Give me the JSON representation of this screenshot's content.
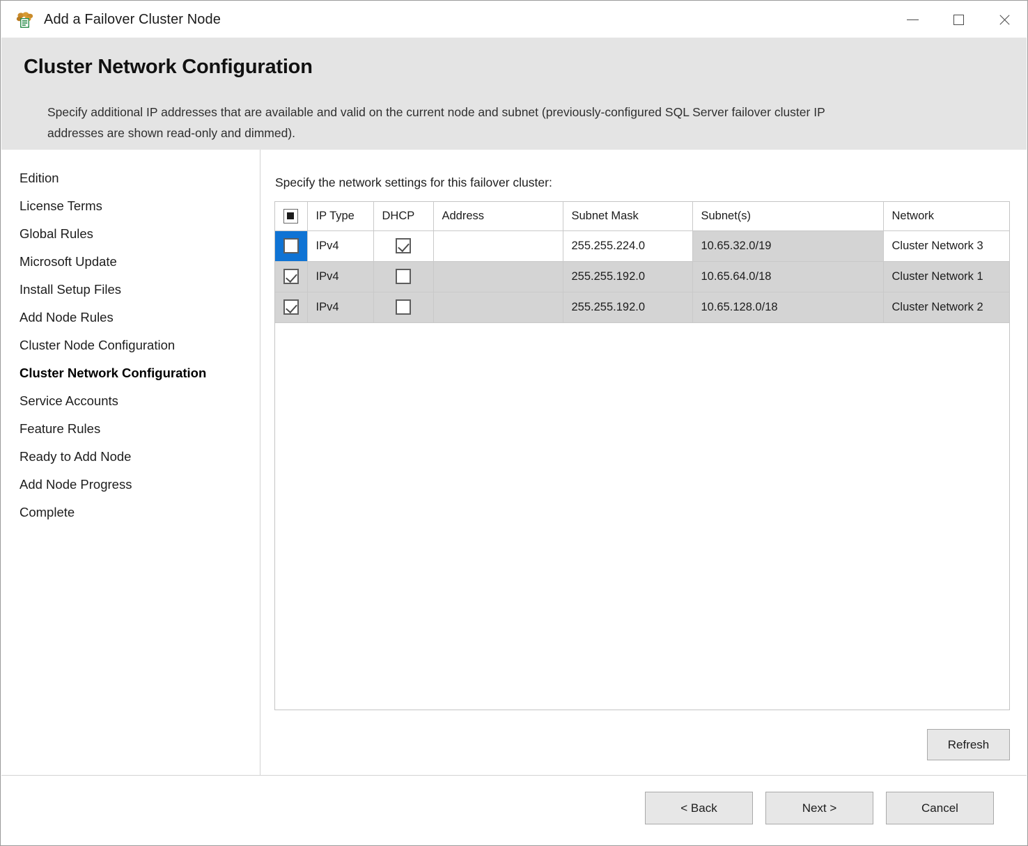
{
  "window": {
    "title": "Add a Failover Cluster Node",
    "icon": "sql-server-cluster-icon",
    "controls": {
      "minimize": "minimize-icon",
      "maximize": "maximize-icon",
      "close": "close-icon"
    }
  },
  "banner": {
    "title": "Cluster Network Configuration",
    "description": "Specify additional IP addresses that are available and valid on the current node and subnet (previously-configured SQL Server failover cluster IP addresses are shown read-only and dimmed)."
  },
  "sidebar": {
    "items": [
      {
        "label": "Edition",
        "current": false
      },
      {
        "label": "License Terms",
        "current": false
      },
      {
        "label": "Global Rules",
        "current": false
      },
      {
        "label": "Microsoft Update",
        "current": false
      },
      {
        "label": "Install Setup Files",
        "current": false
      },
      {
        "label": "Add Node Rules",
        "current": false
      },
      {
        "label": "Cluster Node Configuration",
        "current": false
      },
      {
        "label": "Cluster Network Configuration",
        "current": true
      },
      {
        "label": "Service Accounts",
        "current": false
      },
      {
        "label": "Feature Rules",
        "current": false
      },
      {
        "label": "Ready to Add Node",
        "current": false
      },
      {
        "label": "Add Node Progress",
        "current": false
      },
      {
        "label": "Complete",
        "current": false
      }
    ]
  },
  "main": {
    "instruction": "Specify the network settings for this failover cluster:",
    "grid": {
      "select_all_state": "indeterminate",
      "columns": [
        "",
        "IP Type",
        "DHCP",
        "Address",
        "Subnet Mask",
        "Subnet(s)",
        "Network"
      ],
      "rows": [
        {
          "selected_row": true,
          "checked": false,
          "ip_type": "IPv4",
          "dhcp": true,
          "address": "",
          "subnet_mask": "255.255.224.0",
          "subnets": "10.65.32.0/19",
          "network": "Cluster Network 3",
          "readonly_cells": [
            "subnets"
          ]
        },
        {
          "selected_row": false,
          "checked": true,
          "ip_type": "IPv4",
          "dhcp": false,
          "address": "",
          "subnet_mask": "255.255.192.0",
          "subnets": "10.65.64.0/18",
          "network": "Cluster Network 1",
          "readonly_cells": [
            "ip_type",
            "dhcp",
            "address",
            "subnet_mask",
            "subnets",
            "network"
          ]
        },
        {
          "selected_row": false,
          "checked": true,
          "ip_type": "IPv4",
          "dhcp": false,
          "address": "",
          "subnet_mask": "255.255.192.0",
          "subnets": "10.65.128.0/18",
          "network": "Cluster Network 2",
          "readonly_cells": [
            "ip_type",
            "dhcp",
            "address",
            "subnet_mask",
            "subnets",
            "network"
          ]
        }
      ]
    },
    "refresh_label": "Refresh"
  },
  "footer": {
    "back_label": "< Back",
    "next_label": "Next >",
    "cancel_label": "Cancel"
  },
  "colors": {
    "banner_bg": "#e4e4e4",
    "selection_blue": "#0f73d4",
    "readonly_gray": "#d4d4d4",
    "button_face": "#e7e7e7"
  }
}
